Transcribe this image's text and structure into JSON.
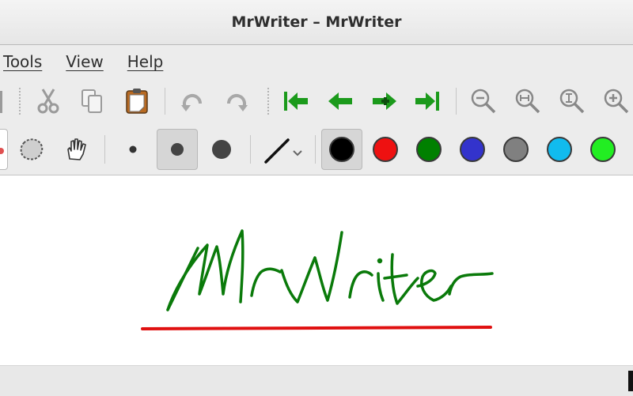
{
  "window": {
    "title": "MrWriter – MrWriter"
  },
  "menu": {
    "items": [
      "Tools",
      "View",
      "Help"
    ]
  },
  "toolbar": {
    "nav_color": "#1b9a1b",
    "icons": [
      "cut-icon",
      "copy-icon",
      "paste-icon",
      "undo-icon",
      "redo-icon",
      "first-page-icon",
      "previous-page-icon",
      "new-page-icon",
      "last-page-icon",
      "zoom-out-icon",
      "zoom-fit-width-icon",
      "zoom-fit-height-icon",
      "zoom-in-icon"
    ]
  },
  "tools": {
    "selected_size": "medium",
    "pen_colors": [
      {
        "name": "black",
        "hex": "#000000",
        "selected": true
      },
      {
        "name": "red",
        "hex": "#ee1111"
      },
      {
        "name": "green",
        "hex": "#008000"
      },
      {
        "name": "blue",
        "hex": "#3333cc"
      },
      {
        "name": "gray",
        "hex": "#808080"
      },
      {
        "name": "light-blue",
        "hex": "#11bbee"
      },
      {
        "name": "light-green",
        "hex": "#22ee22"
      }
    ]
  },
  "canvas": {
    "handwritten_text": "MrWriter",
    "ink_color": "#0a7a0a",
    "underline_color": "#e01010"
  }
}
